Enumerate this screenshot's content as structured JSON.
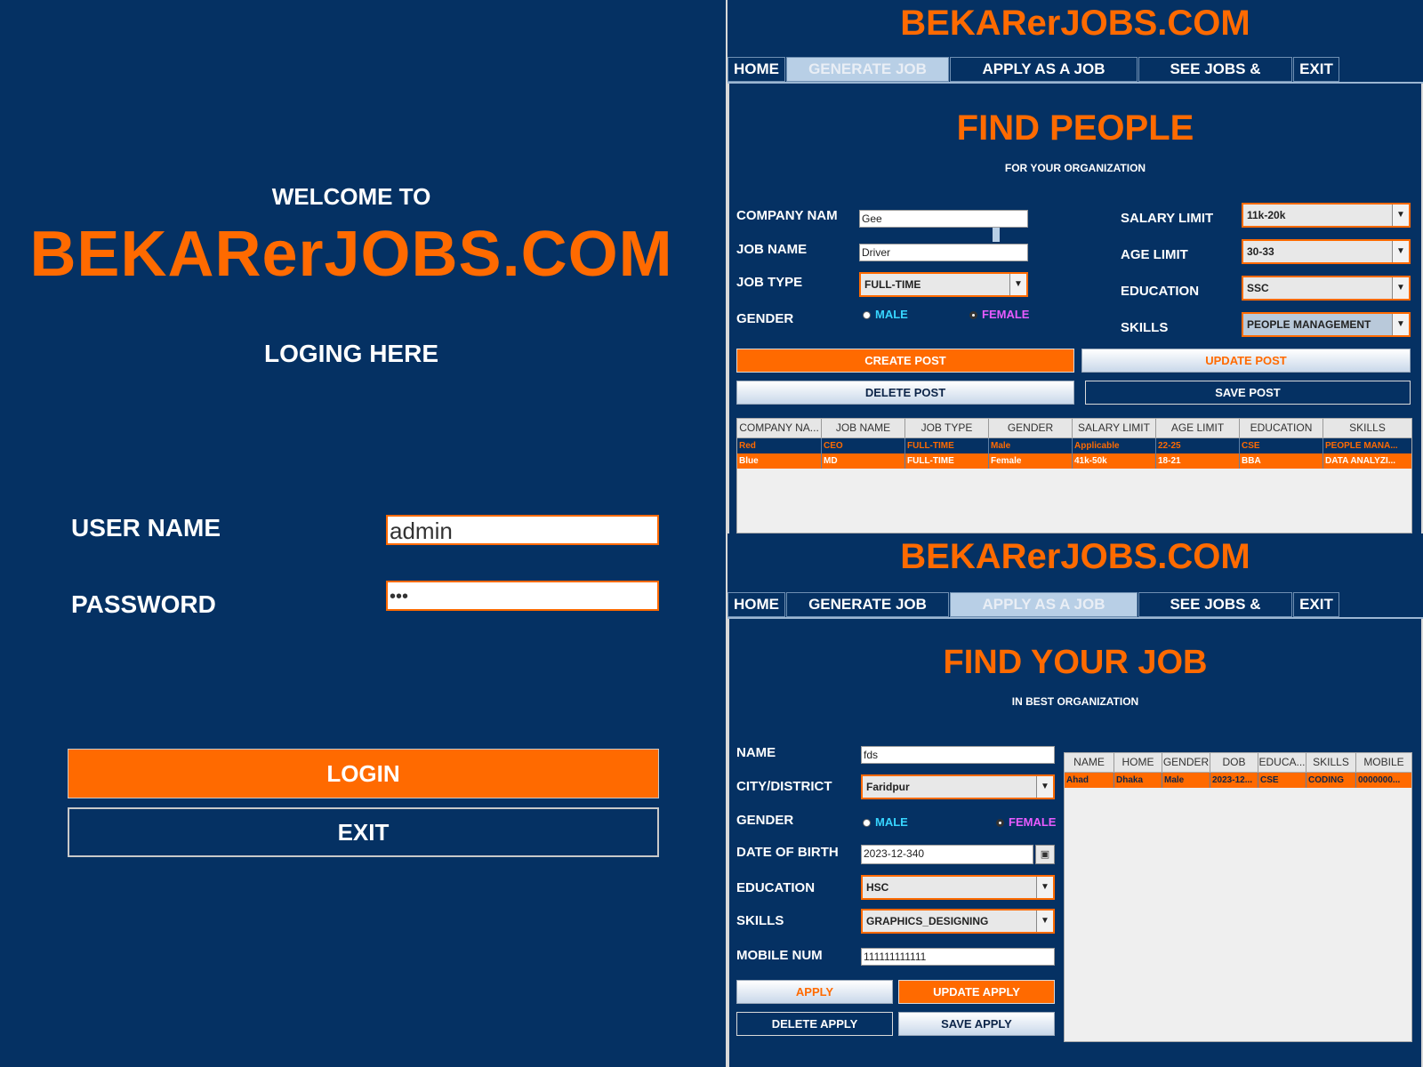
{
  "login": {
    "welcome": "WELCOME TO",
    "brand": "BEKARerJOBS.COM",
    "subtitle": "LOGING HERE",
    "username_label": "USER NAME",
    "username_value": "admin",
    "password_label": "PASSWORD",
    "password_value": "•••",
    "login_button": "LOGIN",
    "exit_button": "EXIT"
  },
  "tabs": [
    "HOME",
    "GENERATE JOB POST",
    "APPLY AS A JOB SEEKER",
    "SEE JOBS & SEEKERS",
    "EXIT"
  ],
  "job_post": {
    "brand": "BEKARerJOBS.COM",
    "active_tab": "GENERATE JOB POST",
    "title": "FIND PEOPLE",
    "subtitle": "FOR YOUR ORGANIZATION",
    "company_label": "COMPANY NAM",
    "company_value": "Gee",
    "job_name_label": "JOB NAME",
    "job_name_value": "Driver",
    "job_type_label": "JOB TYPE",
    "job_type_value": "FULL-TIME",
    "gender_label": "GENDER",
    "gender_male": "MALE",
    "gender_female": "FEMALE",
    "salary_label": "SALARY LIMIT",
    "salary_value": "11k-20k",
    "age_label": "AGE LIMIT",
    "age_value": "30-33",
    "education_label": "EDUCATION",
    "education_value": "SSC",
    "skills_label": "SKILLS",
    "skills_value": "PEOPLE MANAGEMENT",
    "create_button": "CREATE POST",
    "update_button": "UPDATE POST",
    "delete_button": "DELETE POST",
    "save_button": "SAVE POST",
    "table": {
      "headers": [
        "COMPANY NA...",
        "JOB NAME",
        "JOB TYPE",
        "GENDER",
        "SALARY LIMIT",
        "AGE LIMIT",
        "EDUCATION",
        "SKILLS"
      ],
      "rows": [
        [
          "Red",
          "CEO",
          "FULL-TIME",
          "Male",
          "Applicable",
          "22-25",
          "CSE",
          "PEOPLE MANA..."
        ],
        [
          "Blue",
          "MD",
          "FULL-TIME",
          "Female",
          "41k-50k",
          "18-21",
          "BBA",
          "DATA ANALYZI..."
        ]
      ]
    }
  },
  "job_apply": {
    "brand": "BEKARerJOBS.COM",
    "active_tab": "APPLY AS A JOB SEEKER",
    "title": "FIND YOUR JOB",
    "subtitle": "IN BEST ORGANIZATION",
    "name_label": "NAME",
    "name_value": "fds",
    "city_label": "CITY/DISTRICT",
    "city_value": "Faridpur",
    "gender_label": "GENDER",
    "gender_male": "MALE",
    "gender_female": "FEMALE",
    "dob_label": "DATE OF BIRTH",
    "dob_value": "2023-12-340",
    "education_label": "EDUCATION",
    "education_value": "HSC",
    "skills_label": "SKILLS",
    "skills_value": "GRAPHICS_DESIGNING",
    "mobile_label": "MOBILE NUM",
    "mobile_value": "111111111111",
    "apply_button": "APPLY",
    "update_button": "UPDATE APPLY",
    "delete_button": "DELETE APPLY",
    "save_button": "SAVE APPLY",
    "table": {
      "headers": [
        "NAME",
        "HOME",
        "GENDER",
        "DOB",
        "EDUCA...",
        "SKILLS",
        "MOBILE"
      ],
      "rows": [
        [
          "Ahad",
          "Dhaka",
          "Male",
          "2023-12...",
          "CSE",
          "CODING",
          "0000000..."
        ]
      ]
    }
  }
}
